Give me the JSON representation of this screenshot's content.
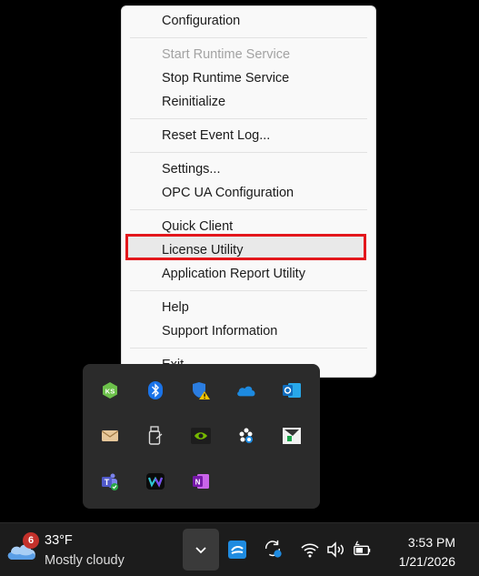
{
  "context_menu": {
    "items": [
      {
        "label": "Configuration",
        "enabled": true
      },
      {
        "label": "Start Runtime Service",
        "enabled": false
      },
      {
        "label": "Stop Runtime Service",
        "enabled": true
      },
      {
        "label": "Reinitialize",
        "enabled": true
      },
      {
        "label": "Reset Event Log...",
        "enabled": true
      },
      {
        "label": "Settings...",
        "enabled": true
      },
      {
        "label": "OPC UA Configuration",
        "enabled": true
      },
      {
        "label": "Quick Client",
        "enabled": true
      },
      {
        "label": "License Utility",
        "enabled": true,
        "highlighted": true
      },
      {
        "label": "Application Report Utility",
        "enabled": true
      },
      {
        "label": "Help",
        "enabled": true
      },
      {
        "label": "Support Information",
        "enabled": true
      },
      {
        "label": "Exit",
        "enabled": true
      }
    ],
    "highlight_color": "#e3171c"
  },
  "tray_flyout": {
    "icons": [
      "kepserver-icon",
      "bluetooth-icon",
      "windows-security-warning-icon",
      "onedrive-icon",
      "outlook-icon",
      "mail-icon",
      "usb-drive-icon",
      "nvidia-icon",
      "slack-icon",
      "driver-tool-icon",
      "teams-icon",
      "webex-icon",
      "onenote-icon"
    ]
  },
  "taskbar": {
    "weather": {
      "badge": "6",
      "temperature": "33°F",
      "condition": "Mostly cloudy"
    },
    "clock": {
      "time": "3:53 PM",
      "date": "1/21/2026"
    }
  }
}
